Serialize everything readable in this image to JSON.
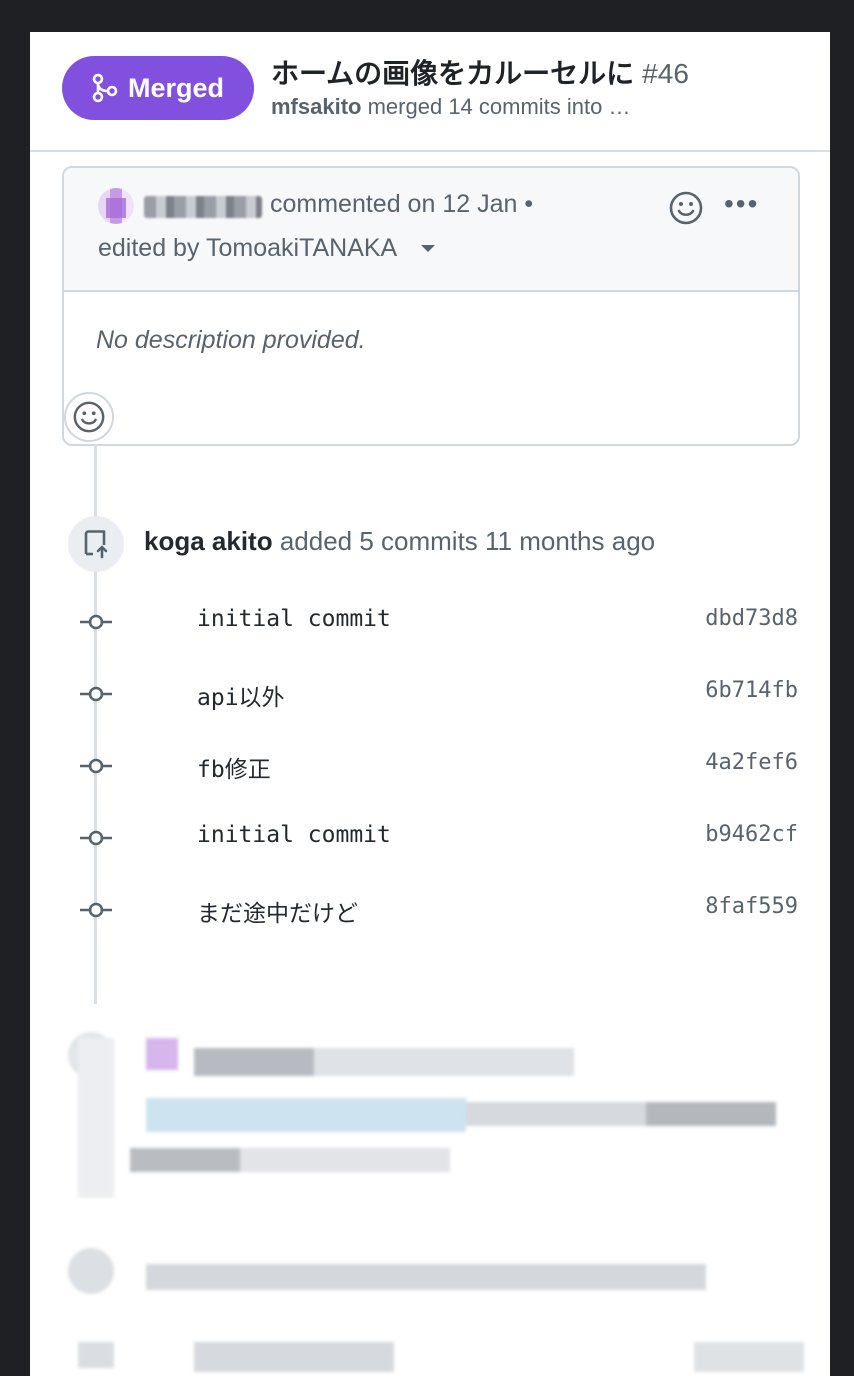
{
  "header": {
    "badge_label": "Merged",
    "title": "ホームの画像をカルーセルに",
    "number": "#46",
    "author": "mfsakito",
    "summary": "merged 14 commits into …"
  },
  "comment": {
    "meta": "commented on 12 Jan •",
    "edited_by": "edited by TomoakiTANAKA",
    "body": "No description provided.",
    "more_label": "•••"
  },
  "push_event": {
    "author": "koga akito",
    "text": "added 5 commits 11 months ago"
  },
  "commits": [
    {
      "message": "initial commit",
      "sha": "dbd73d8"
    },
    {
      "message": "api以外",
      "sha": "6b714fb"
    },
    {
      "message": "fb修正",
      "sha": "4a2fef6"
    },
    {
      "message": "initial commit",
      "sha": "b9462cf"
    },
    {
      "message": "まだ途中だけど",
      "sha": "8faf559"
    }
  ],
  "colors": {
    "merged": "#8250df",
    "muted": "#59636e",
    "border": "#d0d7de",
    "bg_subtle": "#f6f8fa"
  }
}
